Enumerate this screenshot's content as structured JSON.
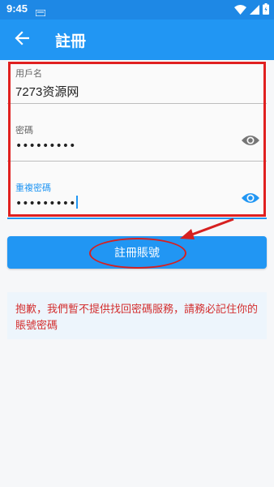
{
  "status_bar": {
    "time": "9:45",
    "icons": [
      "notification-icon",
      "wifi-icon",
      "signal-icon",
      "battery-icon"
    ]
  },
  "app_bar": {
    "title": "註冊",
    "back_icon": "arrow-left-icon"
  },
  "form": {
    "username": {
      "label": "用戶名",
      "value": "7273资源网"
    },
    "password": {
      "label": "密碼",
      "value": "•••••••••",
      "icon": "eye-icon"
    },
    "confirm_password": {
      "label": "重複密碼",
      "value": "•••••••••",
      "icon": "eye-icon",
      "focused": true
    }
  },
  "register_button": {
    "label": "註冊賬號"
  },
  "notice": {
    "text": "抱歉，我們暫不提供找回密碼服務，請務必記住你的賬號密碼"
  },
  "colors": {
    "primary": "#2196f3",
    "status_bar": "#1e88e5",
    "annotation": "#e02020",
    "notice_text": "#d32f2f",
    "notice_bg": "#edf5fc"
  }
}
